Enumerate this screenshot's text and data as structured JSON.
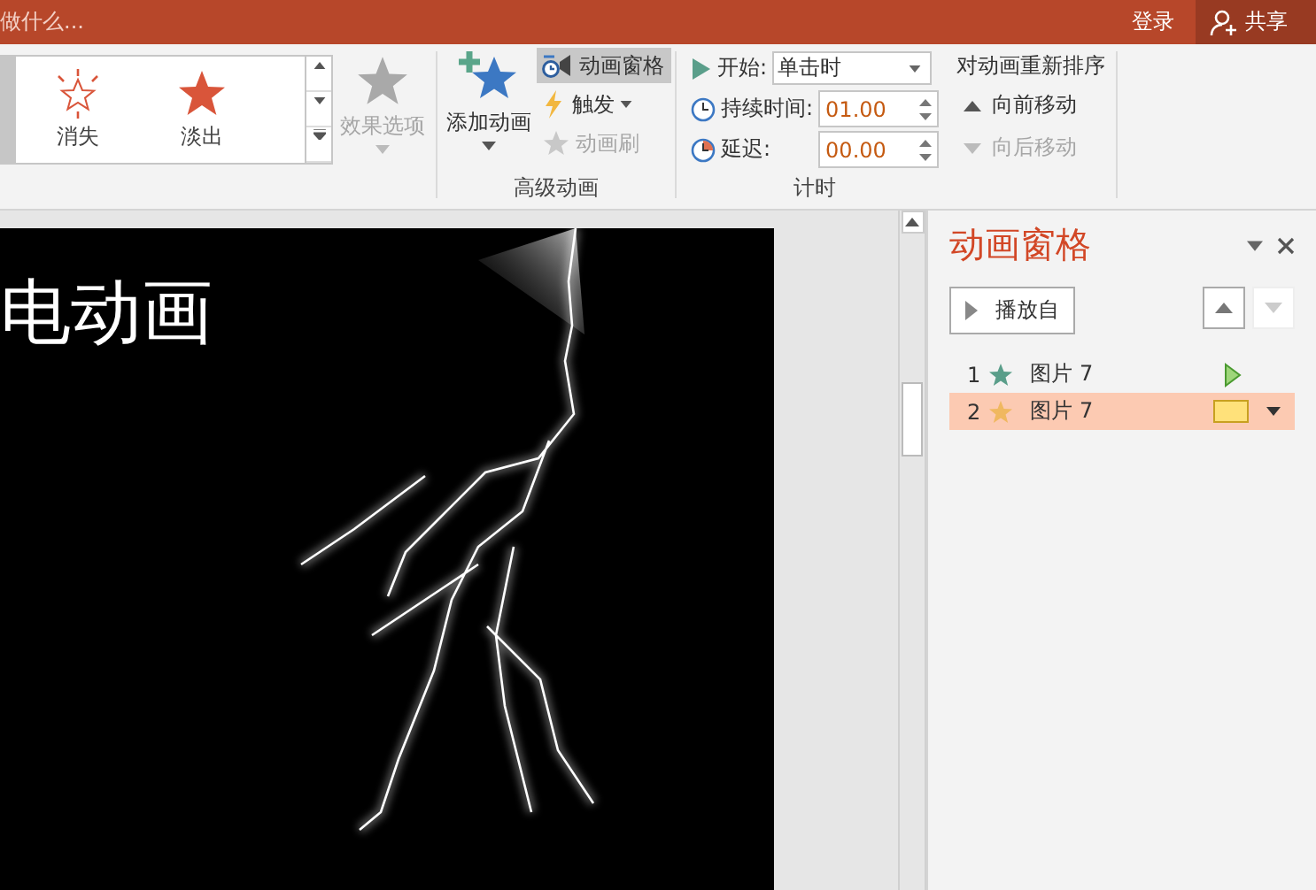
{
  "title_bar": {
    "search_hint": "做什么...",
    "sign_in": "登录",
    "share": "共享"
  },
  "gallery": {
    "items": [
      {
        "label": "消失",
        "kind": "burst"
      },
      {
        "label": "淡出",
        "kind": "star"
      }
    ]
  },
  "effect_options": {
    "label": "效果选项",
    "disabled": true
  },
  "advanced": {
    "group_label": "高级动画",
    "add_label": "添加动画",
    "buttons": [
      {
        "label": "动画窗格",
        "kind": "pane",
        "selected": true,
        "disabled": false
      },
      {
        "label": "触发",
        "kind": "trigger",
        "selected": false,
        "disabled": false
      },
      {
        "label": "动画刷",
        "kind": "painter",
        "selected": false,
        "disabled": true
      }
    ]
  },
  "timing": {
    "group_label": "计时",
    "start_label": "开始:",
    "start_value": "单击时",
    "duration_label": "持续时间:",
    "duration_value": "01.00",
    "delay_label": "延迟:",
    "delay_value": "00.00"
  },
  "reorder": {
    "title": "对动画重新排序",
    "buttons": [
      {
        "label": "向前移动",
        "disabled": false
      },
      {
        "label": "向后移动",
        "disabled": true
      }
    ]
  },
  "slide": {
    "title": "电动画"
  },
  "pane": {
    "title": "动画窗格",
    "play_label": "播放自",
    "up_disabled": false,
    "down_disabled": true,
    "items": [
      {
        "number": "1",
        "name": "图片 7",
        "color": "#5a9e8a",
        "kind": "play",
        "selected": false
      },
      {
        "number": "2",
        "name": "图片 7",
        "color": "#f0b860",
        "kind": "bar",
        "selected": true
      }
    ]
  }
}
